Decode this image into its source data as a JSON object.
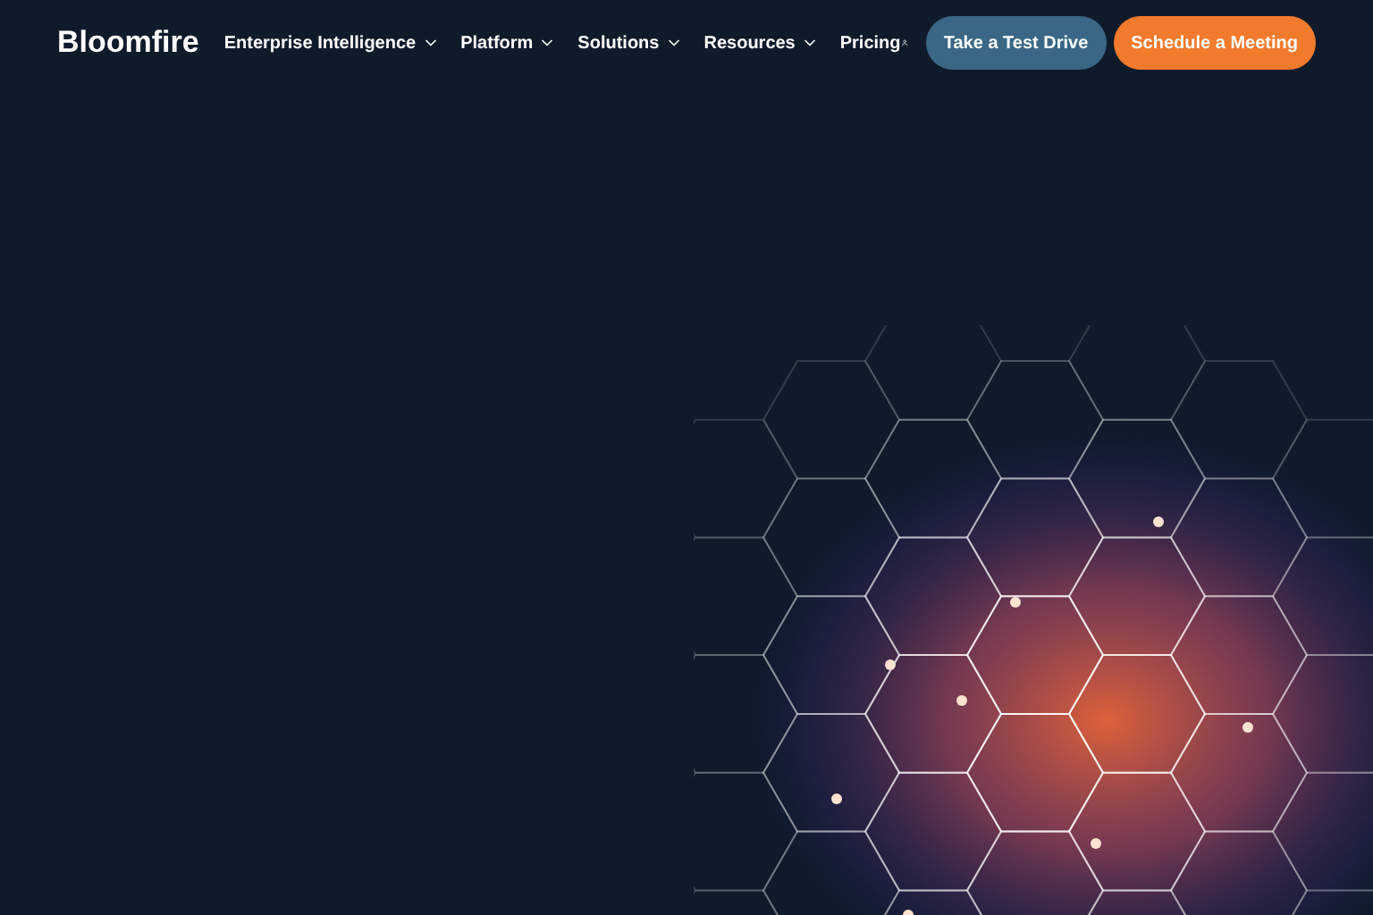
{
  "header": {
    "logo": "Bloomfire",
    "nav": [
      {
        "label": "Enterprise Intelligence",
        "has_dropdown": true
      },
      {
        "label": "Platform",
        "has_dropdown": true
      },
      {
        "label": "Solutions",
        "has_dropdown": true
      },
      {
        "label": "Resources",
        "has_dropdown": true
      },
      {
        "label": "Pricing",
        "has_dropdown": false
      }
    ],
    "buttons": [
      {
        "label": "Take a Test Drive",
        "kind": "secondary"
      },
      {
        "label": "Schedule a Meeting",
        "kind": "primary"
      }
    ]
  }
}
